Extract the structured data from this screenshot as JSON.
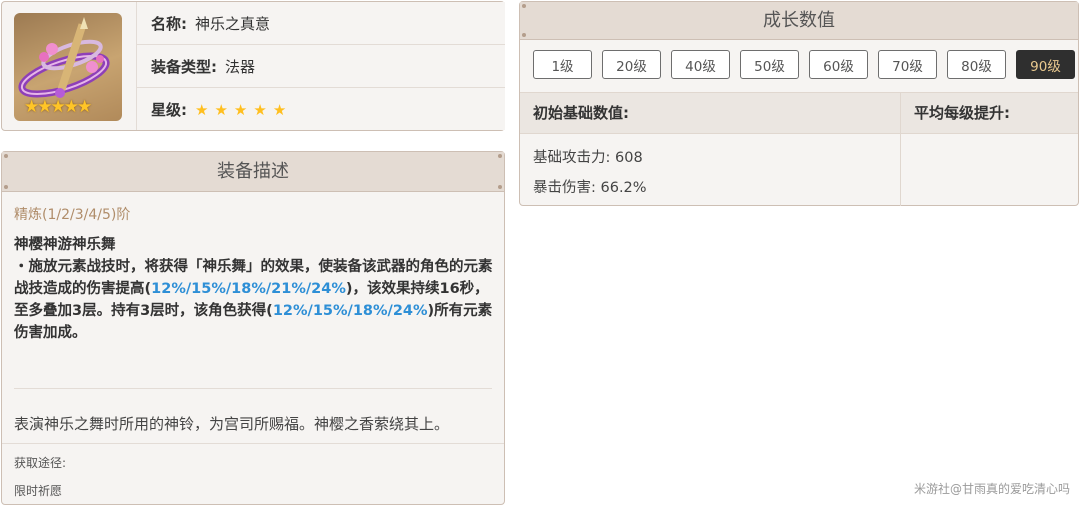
{
  "info": {
    "name_label": "名称:",
    "name_value": "神乐之真意",
    "type_label": "装备类型:",
    "type_value": "法器",
    "rarity_label": "星级:",
    "rarity_stars": 5,
    "thumbnail_icon": "weapon-catalyst-bell-icon"
  },
  "description": {
    "title": "装备描述",
    "refine_text": "精炼(1/2/3/4/5)阶",
    "skill_name": "神樱神游神乐舞",
    "skill_part1": "・施放元素战技时，将获得「神乐舞」的效果，使装备该武器的角色的元素战技造成的伤害提高(",
    "skill_hl1": "12%/15%/18%/21%/24%",
    "skill_part2": ")，该效果持续16秒，至多叠加3层。持有3层时，该角色获得(",
    "skill_hl2": "12%/15%/18%/24%",
    "skill_part3": ")所有元素伤害加成。",
    "flavor": "表演神乐之舞时所用的神铃，为宫司所赐福。神樱之香萦绕其上。",
    "obtain_label": "获取途径:",
    "obtain_value": "限时祈愿"
  },
  "growth": {
    "title": "成长数值",
    "levels": [
      "1级",
      "20级",
      "40级",
      "50级",
      "60级",
      "70级",
      "80级",
      "90级"
    ],
    "active_level": "90级",
    "base_header": "初始基础数值:",
    "avg_header": "平均每级提升:",
    "stat1": "基础攻击力: 608",
    "stat2": "暴击伤害: 66.2%"
  },
  "watermark": "米游社@甘雨真的爱吃清心吗",
  "colors": {
    "accent_blue": "#2e8fd6",
    "star_gold": "#ffbf1f",
    "header_bg": "#e4dbd3",
    "active_level_bg": "#2f2f2f",
    "active_level_text": "#e9c98f"
  }
}
